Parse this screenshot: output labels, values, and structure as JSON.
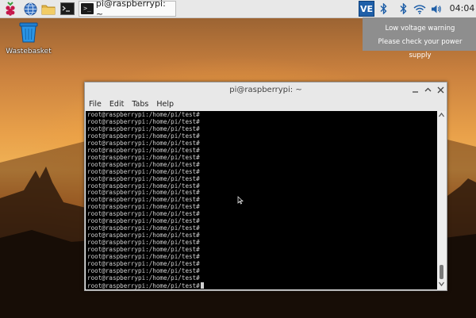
{
  "taskbar": {
    "launchers": [
      "raspberry-icon",
      "globe-icon",
      "folder-icon",
      "terminal-icon"
    ],
    "task_button_label": "pi@raspberrypi: ~",
    "tray": {
      "vnc_label": "VE",
      "clock": "04:04"
    }
  },
  "desktop": {
    "wastebasket_label": "Wastebasket"
  },
  "notification": {
    "line1": "Low voltage warning",
    "line2": "Please check your power supply"
  },
  "terminal_window": {
    "title": "pi@raspberrypi: ~",
    "menu": [
      "File",
      "Edit",
      "Tabs",
      "Help"
    ],
    "lines": [
      "root@raspberrypi:/home/pi/test#",
      "root@raspberrypi:/home/pi/test#",
      "root@raspberrypi:/home/pi/test#",
      "root@raspberrypi:/home/pi/test#",
      "root@raspberrypi:/home/pi/test#",
      "root@raspberrypi:/home/pi/test#",
      "root@raspberrypi:/home/pi/test#",
      "root@raspberrypi:/home/pi/test#",
      "root@raspberrypi:/home/pi/test#",
      "root@raspberrypi:/home/pi/test#",
      "root@raspberrypi:/home/pi/test#",
      "root@raspberrypi:/home/pi/test#",
      "root@raspberrypi:/home/pi/test#",
      "root@raspberrypi:/home/pi/test#",
      "root@raspberrypi:/home/pi/test#",
      "root@raspberrypi:/home/pi/test#",
      "root@raspberrypi:/home/pi/test#",
      "root@raspberrypi:/home/pi/test#",
      "root@raspberrypi:/home/pi/test#",
      "root@raspberrypi:/home/pi/test#",
      "root@raspberrypi:/home/pi/test#",
      "root@raspberrypi:/home/pi/test#",
      "root@raspberrypi:/home/pi/test#",
      "root@raspberrypi:/home/pi/test#",
      "root@raspberrypi:/home/pi/test#"
    ]
  }
}
